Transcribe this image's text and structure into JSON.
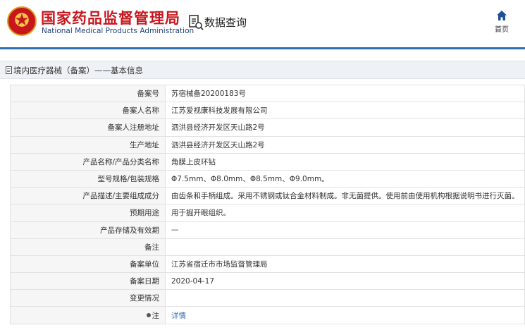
{
  "header": {
    "brand_cn": "国家药品监督管理局",
    "brand_en": "National Medical Products Administration",
    "query_title": "数据查询",
    "home_label": "首页",
    "accent_color": "#2f6db5",
    "brand_color": "#c8161d"
  },
  "section": {
    "title": "境内医疗器械（备案）——基本信息"
  },
  "record": {
    "rows": [
      {
        "label": "备案号",
        "value": "苏宿械备20200183号"
      },
      {
        "label": "备案人名称",
        "value": "江苏爱视康科技发展有限公司"
      },
      {
        "label": "备案人注册地址",
        "value": "泗洪县经济开发区天山路2号"
      },
      {
        "label": "生产地址",
        "value": "泗洪县经济开发区天山路2号"
      },
      {
        "label": "产品名称/产品分类名称",
        "value": "角膜上皮环钻"
      },
      {
        "label": "型号规格/包装规格",
        "value": "Φ7.5mm、Φ8.0mm、Φ8.5mm、Φ9.0mm。"
      },
      {
        "label": "产品描述/主要组成成分",
        "value": "由齿条和手柄组成。采用不锈钢或钛合金材料制成。非无菌提供。使用前由使用机构根据说明书进行灭菌。"
      },
      {
        "label": "预期用途",
        "value": "用于掘开眼组织。"
      },
      {
        "label": "产品存储及有效期",
        "value": "—"
      },
      {
        "label": "备注",
        "value": ""
      },
      {
        "label": "备案单位",
        "value": "江苏省宿迁市市场监督管理局"
      },
      {
        "label": "备案日期",
        "value": "2020-04-17"
      },
      {
        "label": "变更情况",
        "value": ""
      }
    ],
    "note_label": "注",
    "detail_link": "详情"
  }
}
